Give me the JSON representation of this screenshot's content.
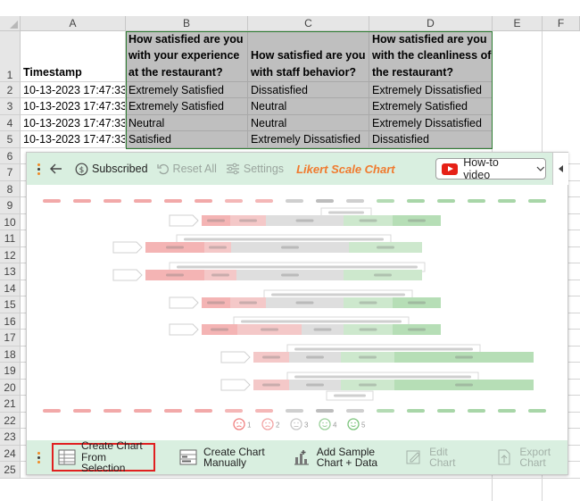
{
  "columns": [
    "A",
    "B",
    "C",
    "D",
    "E",
    "F"
  ],
  "rows": [
    "1",
    "2",
    "3",
    "4",
    "5",
    "6",
    "7",
    "8",
    "9",
    "10",
    "11",
    "12",
    "13",
    "14",
    "15",
    "16",
    "17",
    "18",
    "19",
    "20",
    "21",
    "22",
    "23",
    "24",
    "25"
  ],
  "header": {
    "a1": "Timestamp",
    "b1": "How satisfied are you with your experience at the restaurant?",
    "c1": "How satisfied are you with staff behavior?",
    "d1": "How satisfied are you with the cleanliness of the restaurant?"
  },
  "data_rows": [
    {
      "a": "10-13-2023 17:47:33",
      "b": "Extremely Satisfied",
      "c": "Dissatisfied",
      "d": "Extremely Dissatisfied"
    },
    {
      "a": "10-13-2023 17:47:33",
      "b": "Extremely Satisfied",
      "c": "Neutral",
      "d": "Extremely Satisfied"
    },
    {
      "a": "10-13-2023 17:47:33",
      "b": "Neutral",
      "c": "Neutral",
      "d": "Extremely Dissatisfied"
    },
    {
      "a": "10-13-2023 17:47:33",
      "b": "Satisfied",
      "c": "Extremely Dissatisfied",
      "d": "Dissatisfied"
    }
  ],
  "toolbar": {
    "subscribed": "Subscribed",
    "reset_all": "Reset All",
    "settings": "Settings",
    "title": "Likert Scale Chart",
    "howto": "How-to video"
  },
  "legend_numbers": [
    "1",
    "2",
    "3",
    "4",
    "5"
  ],
  "bottom": {
    "create_selection": [
      "Create Chart",
      "From Selection"
    ],
    "create_manual": [
      "Create Chart",
      "Manually"
    ],
    "add_sample": [
      "Add Sample",
      "Chart + Data"
    ],
    "edit": [
      "Edit",
      "Chart"
    ],
    "export": [
      "Export",
      "Chart"
    ]
  },
  "colors": {
    "accent_green": "#d9efe0",
    "selection_red": "#e02020",
    "title_orange": "#f07a2e",
    "youtube_red": "#e62117"
  },
  "icons": {
    "back": "back-arrow-icon",
    "subscribed": "dollar-circle-icon",
    "reset": "undo-icon",
    "settings": "sliders-icon",
    "youtube": "youtube-icon",
    "dropdown": "chevron-down-icon",
    "collapse": "triangle-left-icon"
  }
}
